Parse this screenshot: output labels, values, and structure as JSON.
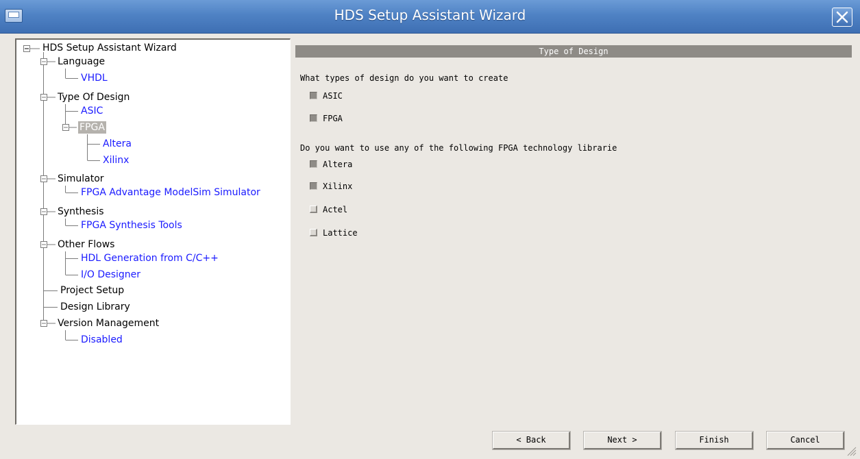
{
  "window": {
    "title": "HDS Setup Assistant Wizard"
  },
  "tree": {
    "root": "HDS Setup Assistant Wizard",
    "language": "Language",
    "vhdl": "VHDL",
    "type_of_design": "Type Of Design",
    "asic": "ASIC",
    "fpga": "FPGA",
    "altera": "Altera",
    "xilinx": "Xilinx",
    "simulator": "Simulator",
    "modelsim": "FPGA Advantage ModelSim Simulator",
    "synthesis": "Synthesis",
    "synth_tools": "FPGA Synthesis Tools",
    "other_flows": "Other Flows",
    "hdl_gen": "HDL Generation from C/C++",
    "io_designer": "I/O Designer",
    "project_setup": "Project Setup",
    "design_library": "Design Library",
    "version_mgmt": "Version Management",
    "disabled": "Disabled"
  },
  "panel": {
    "header": "Type of Design",
    "question1": "What types of design do you want to create",
    "question2": "Do you want to use any of the following FPGA technology librarie",
    "design_types": [
      {
        "label": "ASIC",
        "checked": true
      },
      {
        "label": "FPGA",
        "checked": true
      }
    ],
    "fpga_libraries": [
      {
        "label": "Altera",
        "checked": true
      },
      {
        "label": "Xilinx",
        "checked": true
      },
      {
        "label": "Actel",
        "checked": false
      },
      {
        "label": "Lattice",
        "checked": false
      }
    ]
  },
  "buttons": {
    "back": "< Back",
    "next": "Next >",
    "finish": "Finish",
    "cancel": "Cancel"
  },
  "colors": {
    "titlebar": "#4f82c4",
    "leaf_link": "#1a1aff",
    "header_bg": "#8e8b86",
    "window_bg": "#ebe8e3"
  }
}
